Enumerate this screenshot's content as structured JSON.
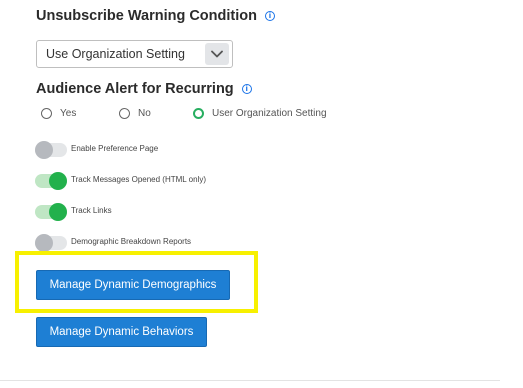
{
  "unsubscribe": {
    "title": "Unsubscribe Warning Condition",
    "info_icon": "info-icon",
    "select_value": "Use Organization Setting",
    "chevron_icon": "chevron-down-icon"
  },
  "audience_alert": {
    "title": "Audience Alert for Recurring",
    "info_icon": "info-icon",
    "options": [
      {
        "label": "Yes",
        "selected": false
      },
      {
        "label": "No",
        "selected": false
      },
      {
        "label": "User Organization Setting",
        "selected": true
      }
    ]
  },
  "toggles": [
    {
      "label": "Enable Preference Page",
      "on": false
    },
    {
      "label": "Track Messages Opened (HTML only)",
      "on": true
    },
    {
      "label": "Track Links",
      "on": true
    },
    {
      "label": "Demographic Breakdown Reports",
      "on": false
    }
  ],
  "buttons": {
    "manage_demographics": "Manage Dynamic Demographics",
    "manage_behaviors": "Manage Dynamic Behaviors"
  },
  "colors": {
    "accent_blue": "#1e7fd4",
    "toggle_on": "#22b14c",
    "toggle_off": "#b6b9be",
    "highlight": "#f7f000",
    "info_blue": "#1a73e8"
  }
}
